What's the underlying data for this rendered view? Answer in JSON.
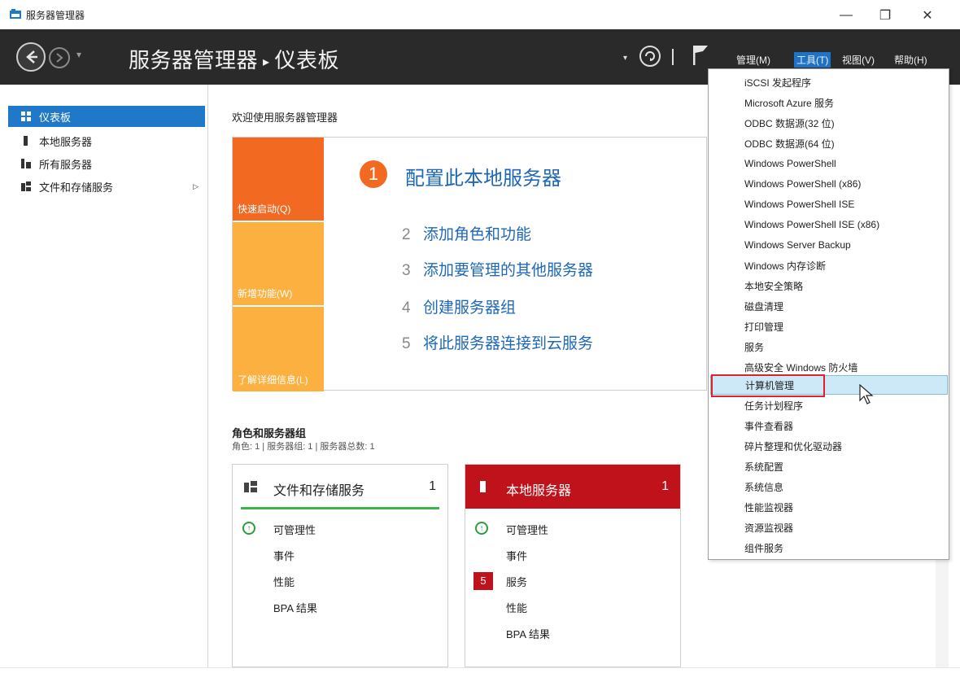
{
  "window": {
    "title": "服务器管理器",
    "min": "—",
    "max": "❐",
    "close": "✕"
  },
  "header": {
    "breadcrumb_app": "服务器管理器",
    "breadcrumb_sep": "▸",
    "breadcrumb_page": "仪表板",
    "menus": {
      "manage": "管理(M)",
      "tools": "工具(T)",
      "view": "视图(V)",
      "help": "帮助(H)"
    }
  },
  "sidebar": {
    "items": [
      {
        "label": "仪表板",
        "active": true
      },
      {
        "label": "本地服务器"
      },
      {
        "label": "所有服务器"
      },
      {
        "label": "文件和存储服务"
      }
    ]
  },
  "main": {
    "welcome": "欢迎使用服务器管理器",
    "tiles": [
      "快速启动(Q)",
      "新增功能(W)",
      "了解详细信息(L)"
    ],
    "step1": {
      "num": "1",
      "label": "配置此本地服务器"
    },
    "steps": [
      {
        "num": "2",
        "label": "添加角色和功能"
      },
      {
        "num": "3",
        "label": "添加要管理的其他服务器"
      },
      {
        "num": "4",
        "label": "创建服务器组"
      },
      {
        "num": "5",
        "label": "将此服务器连接到云服务"
      }
    ],
    "roles_title": "角色和服务器组",
    "roles_sub": "角色: 1 | 服务器组: 1 | 服务器总数: 1",
    "cards": [
      {
        "title": "文件和存储服务",
        "count": "1",
        "rows": [
          "可管理性",
          "事件",
          "性能",
          "BPA 结果"
        ]
      },
      {
        "title": "本地服务器",
        "count": "1",
        "rows": [
          "可管理性",
          "事件",
          "服务",
          "性能",
          "BPA 结果"
        ],
        "badge": "5"
      }
    ]
  },
  "tools_menu": {
    "items": [
      "iSCSI 发起程序",
      "Microsoft Azure 服务",
      "ODBC 数据源(32 位)",
      "ODBC 数据源(64 位)",
      "Windows PowerShell",
      "Windows PowerShell (x86)",
      "Windows PowerShell ISE",
      "Windows PowerShell ISE (x86)",
      "Windows Server Backup",
      "Windows 内存诊断",
      "本地安全策略",
      "磁盘清理",
      "打印管理",
      "服务",
      "高级安全 Windows 防火墙",
      "计算机管理",
      "任务计划程序",
      "事件查看器",
      "碎片整理和优化驱动器",
      "系统配置",
      "系统信息",
      "性能监视器",
      "资源监视器",
      "组件服务"
    ],
    "highlighted": "计算机管理"
  },
  "colors": {
    "header_bg": "#2a2a2a",
    "accent_blue": "#1f78c8",
    "quickstart_orange": "#f26a22",
    "tile_yellow": "#fbb040",
    "alert_red": "#c0121a",
    "ok_green": "#39b54a"
  }
}
